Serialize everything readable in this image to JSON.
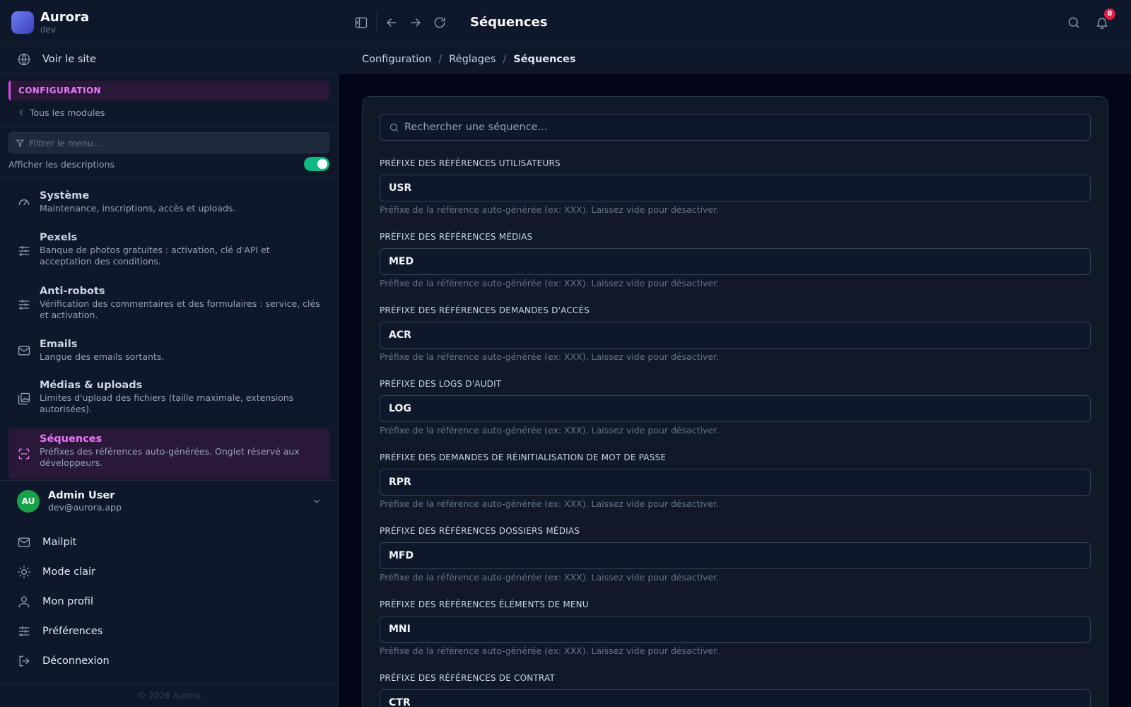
{
  "brand": {
    "name": "Aurora",
    "env": "dev"
  },
  "sidebar": {
    "visit_site": "Voir le site",
    "section": "CONFIGURATION",
    "back": "Tous les modules",
    "filter_placeholder": "Filtrer le menu...",
    "toggle_label": "Afficher les descriptions",
    "toggle_on": true,
    "items": [
      {
        "title": "Système",
        "desc": "Maintenance, inscriptions, accès et uploads.",
        "icon": "gauge-icon"
      },
      {
        "title": "Pexels",
        "desc": "Banque de photos gratuites : activation, clé d'API et acceptation des conditions.",
        "icon": "sliders-icon"
      },
      {
        "title": "Anti-robots",
        "desc": "Vérification des commentaires et des formulaires : service, clés et activation.",
        "icon": "sliders-icon"
      },
      {
        "title": "Emails",
        "desc": "Langue des emails sortants.",
        "icon": "mail-icon"
      },
      {
        "title": "Médias & uploads",
        "desc": "Limites d'upload des fichiers (taille maximale, extensions autorisées).",
        "icon": "images-icon"
      },
      {
        "title": "Séquences",
        "desc": "Préfixes des références auto-générées. Onglet réservé aux développeurs.",
        "icon": "scan-icon",
        "active": true
      }
    ],
    "user": {
      "initials": "AU",
      "name": "Admin User",
      "email": "dev@aurora.app"
    },
    "bottom": [
      {
        "label": "Mailpit",
        "icon": "mail-icon"
      },
      {
        "label": "Mode clair",
        "icon": "sun-icon"
      },
      {
        "label": "Mon profil",
        "icon": "user-icon"
      },
      {
        "label": "Préférences",
        "icon": "sliders-icon"
      },
      {
        "label": "Déconnexion",
        "icon": "logout-icon"
      }
    ],
    "copyright": "© 2026 Aurora"
  },
  "header": {
    "title": "Séquences",
    "notifications": "8"
  },
  "breadcrumb": [
    "Configuration",
    "Réglages",
    "Séquences"
  ],
  "main": {
    "search_placeholder": "Rechercher une séquence...",
    "fields": [
      {
        "label": "PRÉFIXE DES RÉFÉRENCES UTILISATEURS",
        "value": "USR",
        "help": "Préfixe de la référence auto-générée (ex: XXX). Laissez vide pour désactiver."
      },
      {
        "label": "PRÉFIXE DES RÉFÉRENCES MÉDIAS",
        "value": "MED",
        "help": "Préfixe de la référence auto-générée (ex: XXX). Laissez vide pour désactiver."
      },
      {
        "label": "PRÉFIXE DES RÉFÉRENCES DEMANDES D'ACCÈS",
        "value": "ACR",
        "help": "Préfixe de la référence auto-générée (ex: XXX). Laissez vide pour désactiver."
      },
      {
        "label": "PRÉFIXE DES LOGS D'AUDIT",
        "value": "LOG",
        "help": "Préfixe de la référence auto-générée (ex: XXX). Laissez vide pour désactiver."
      },
      {
        "label": "PRÉFIXE DES DEMANDES DE RÉINITIALISATION DE MOT DE PASSE",
        "value": "RPR",
        "help": "Préfixe de la référence auto-générée (ex: XXX). Laissez vide pour désactiver."
      },
      {
        "label": "PRÉFIXE DES RÉFÉRENCES DOSSIERS MÉDIAS",
        "value": "MFD",
        "help": "Préfixe de la référence auto-générée (ex: XXX). Laissez vide pour désactiver."
      },
      {
        "label": "PRÉFIXE DES RÉFÉRENCES ÉLÉMENTS DE MENU",
        "value": "MNI",
        "help": "Préfixe de la référence auto-générée (ex: XXX). Laissez vide pour désactiver."
      },
      {
        "label": "PRÉFIXE DES RÉFÉRENCES DE CONTRAT",
        "value": "CTR",
        "help": ""
      }
    ]
  },
  "colors": {
    "accent": "#e879f9",
    "toggle": "#10b981",
    "badge": "#e11d48"
  }
}
